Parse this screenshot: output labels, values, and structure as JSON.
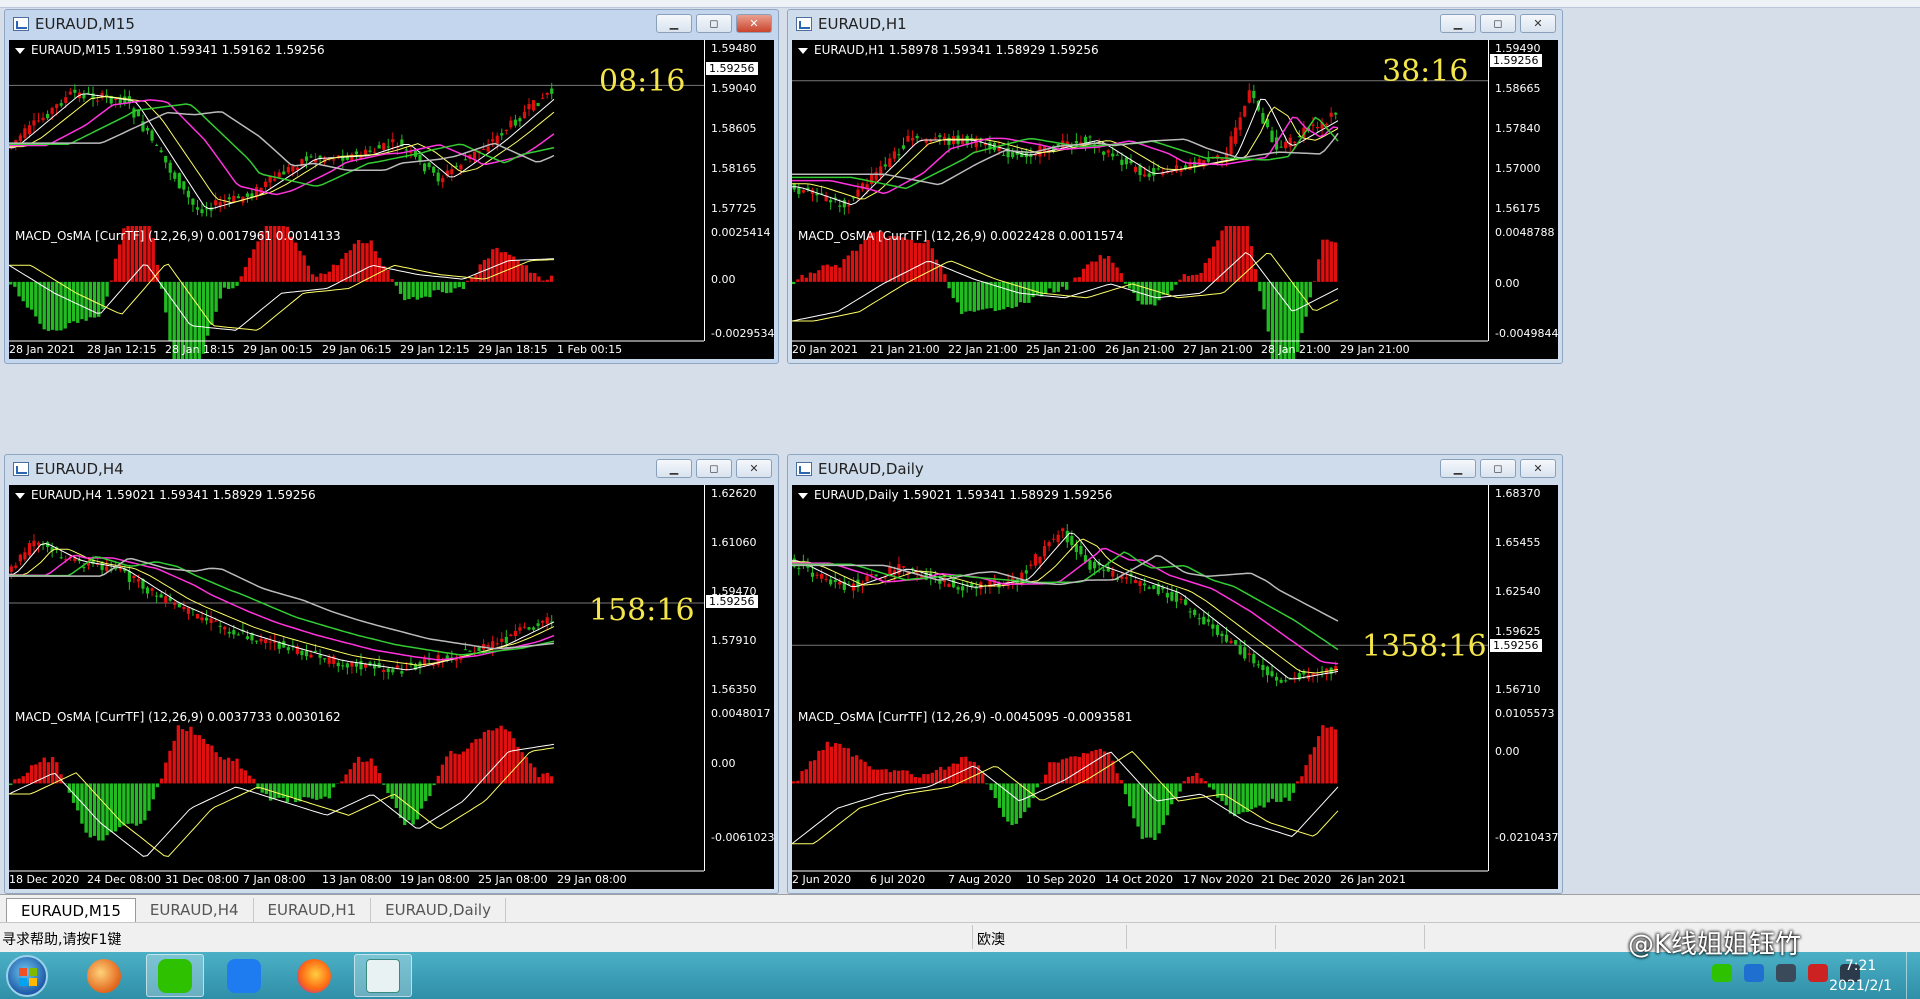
{
  "colors": {
    "bull": "#e01010",
    "bear": "#22bb22",
    "ma_fast": "#ffffff",
    "ma_yellow": "#ffff66",
    "ma_magenta": "#ff33dd",
    "ma_green": "#33cc33",
    "ma_gray": "#bbbbbb",
    "timer": "#f4e64a"
  },
  "windows": [
    {
      "title": "EURAUD,M15",
      "header": "EURAUD,M15  1.59180 1.59341 1.59162 1.59256",
      "timer": "08:16",
      "yaxis": [
        "1.59480",
        "1.59040",
        "1.58605",
        "1.58165",
        "1.57725"
      ],
      "price": "1.59256",
      "macd_header": "MACD_OsMA [CurrTF] (12,26,9) 0.0017961 0.0014133",
      "macd_axis": [
        "0.0025414",
        "0.00",
        "-0.0029534"
      ],
      "xaxis": [
        "28 Jan 2021",
        "28 Jan 12:15",
        "28 Jan 18:15",
        "29 Jan 00:15",
        "29 Jan 06:15",
        "29 Jan 12:15",
        "29 Jan 18:15",
        "1 Feb 00:15"
      ]
    },
    {
      "title": "EURAUD,H1",
      "header": "EURAUD,H1  1.58978 1.59341 1.58929 1.59256",
      "timer": "38:16",
      "yaxis": [
        "1.59490",
        "1.58665",
        "1.57840",
        "1.57000",
        "1.56175"
      ],
      "price": "1.59256",
      "macd_header": "MACD_OsMA [CurrTF] (12,26,9) 0.0022428 0.0011574",
      "macd_axis": [
        "0.0048788",
        "0.00",
        "-0.0049844"
      ],
      "xaxis": [
        "20 Jan 2021",
        "21 Jan 21:00",
        "22 Jan 21:00",
        "25 Jan 21:00",
        "26 Jan 21:00",
        "27 Jan 21:00",
        "28 Jan 21:00",
        "29 Jan 21:00"
      ]
    },
    {
      "title": "EURAUD,H4",
      "header": "EURAUD,H4  1.59021 1.59341 1.58929 1.59256",
      "timer": "158:16",
      "yaxis": [
        "1.62620",
        "1.61060",
        "1.59470",
        "1.57910",
        "1.56350"
      ],
      "price": "1.59256",
      "macd_header": "MACD_OsMA [CurrTF] (12,26,9) 0.0037733 0.0030162",
      "macd_axis": [
        "0.0048017",
        "0.00",
        "-0.0061023"
      ],
      "xaxis": [
        "18 Dec 2020",
        "24 Dec 08:00",
        "31 Dec 08:00",
        "7 Jan 08:00",
        "13 Jan 08:00",
        "19 Jan 08:00",
        "25 Jan 08:00",
        "29 Jan 08:00"
      ]
    },
    {
      "title": "EURAUD,Daily",
      "header": "EURAUD,Daily  1.59021 1.59341 1.58929 1.59256",
      "timer": "1358:16",
      "yaxis": [
        "1.68370",
        "1.65455",
        "1.62540",
        "1.59625",
        "1.56710"
      ],
      "price": "1.59256",
      "macd_header": "MACD_OsMA [CurrTF] (12,26,9) -0.0045095 -0.0093581",
      "macd_axis": [
        "0.0105573",
        "0.00",
        "-0.0210437"
      ],
      "xaxis": [
        "2 Jun 2020",
        "6 Jul 2020",
        "7 Aug 2020",
        "10 Sep 2020",
        "14 Oct 2020",
        "17 Nov 2020",
        "21 Dec 2020",
        "26 Jan 2021"
      ]
    }
  ],
  "tabs": [
    "EURAUD,M15",
    "EURAUD,H4",
    "EURAUD,H1",
    "EURAUD,Daily"
  ],
  "status": {
    "help": "寻求帮助,请按F1键",
    "profile": "欧澳"
  },
  "taskbar": {
    "time": "7:21",
    "date": "2021/2/1"
  },
  "watermark": "@K线姐姐钰竹",
  "icons": [
    "windows-start-icon",
    "media-player-icon",
    "wechat-icon",
    "note-icon",
    "firefox-icon",
    "trading-terminal-icon",
    "wechat-tray-icon",
    "shield-tray-icon",
    "network-tray-icon",
    "volume-muted-tray-icon",
    "signal-tray-icon"
  ]
}
